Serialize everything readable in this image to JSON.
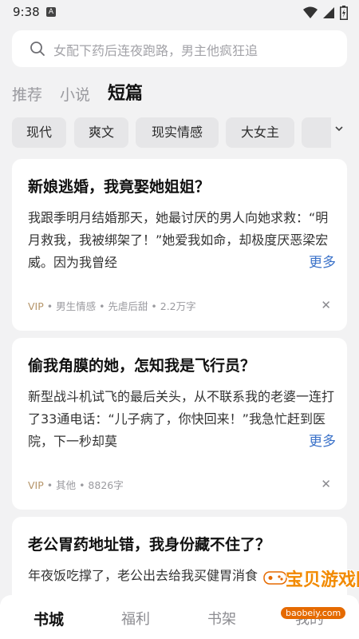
{
  "status_bar": {
    "time": "9:38",
    "notification_icon": "A"
  },
  "search": {
    "placeholder": "女配下药后连夜跑路，男主他疯狂追"
  },
  "tabs": [
    {
      "label": "推荐",
      "active": false
    },
    {
      "label": "小说",
      "active": false
    },
    {
      "label": "短篇",
      "active": true
    }
  ],
  "categories": [
    "现代",
    "爽文",
    "现实情感",
    "大女主"
  ],
  "cards": [
    {
      "title": "新娘逃婚，我竟娶她姐姐？",
      "summary": "我跟季明月结婚那天，她最讨厌的男人向她求救：“明月救我，我被绑架了！”她爱我如命，却极度厌恶梁宏威。因为我曾经",
      "more": "更多",
      "vip": "VIP",
      "meta": " • 男生情感 • 先虐后甜 • 2.2万字"
    },
    {
      "title": "偷我角膜的她，怎知我是飞行员？",
      "summary": "新型战斗机试飞的最后关头，从不联系我的老婆一连打了33通电话：“儿子病了，你快回来！”我急忙赶到医院，下一秒却莫",
      "more": "更多",
      "vip": "VIP",
      "meta": " • 其他 • 8826字"
    },
    {
      "title": "老公胃药地址错，我身份藏不住了？",
      "summary": "年夜饭吃撑了，老公出去给我买健胃消食",
      "more": "",
      "vip": "",
      "meta": ""
    }
  ],
  "bottom_nav": [
    {
      "label": "书城",
      "active": true
    },
    {
      "label": "福利",
      "active": false
    },
    {
      "label": "书架",
      "active": false
    },
    {
      "label": "我的",
      "active": false
    }
  ],
  "watermark": {
    "text": "宝贝游戏网",
    "url": "baobeiy.com"
  },
  "colors": {
    "accent_link": "#3b72c9",
    "vip": "#b5956a",
    "background": "#f2f2f3"
  }
}
